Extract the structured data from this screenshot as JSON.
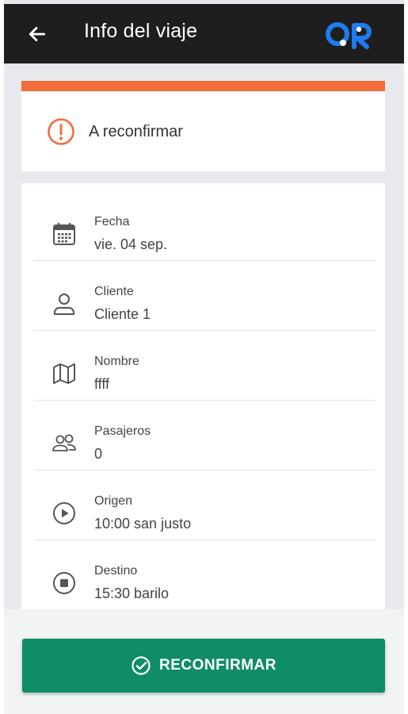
{
  "appbar": {
    "title": "Info del viaje",
    "back_icon": "arrow-left-icon",
    "logo_text": "QR",
    "logo_color": "#1e7bf0"
  },
  "status": {
    "text": "A reconfirmar",
    "icon": "alert-circle-icon",
    "accent_color": "#f26c3c"
  },
  "details": [
    {
      "icon": "calendar-icon",
      "label": "Fecha",
      "value": "vie. 04 sep."
    },
    {
      "icon": "user-icon",
      "label": "Cliente",
      "value": "Cliente 1"
    },
    {
      "icon": "map-icon",
      "label": "Nombre",
      "value": "ffff"
    },
    {
      "icon": "users-icon",
      "label": "Pasajeros",
      "value": "0"
    },
    {
      "icon": "play-circle-icon",
      "label": "Origen",
      "value": "10:00 san justo"
    },
    {
      "icon": "stop-circle-icon",
      "label": "Destino",
      "value": "15:30 barilo"
    }
  ],
  "cta": {
    "label": "RECONFIRMAR",
    "icon": "check-circle-icon",
    "color": "#0f8c68"
  }
}
